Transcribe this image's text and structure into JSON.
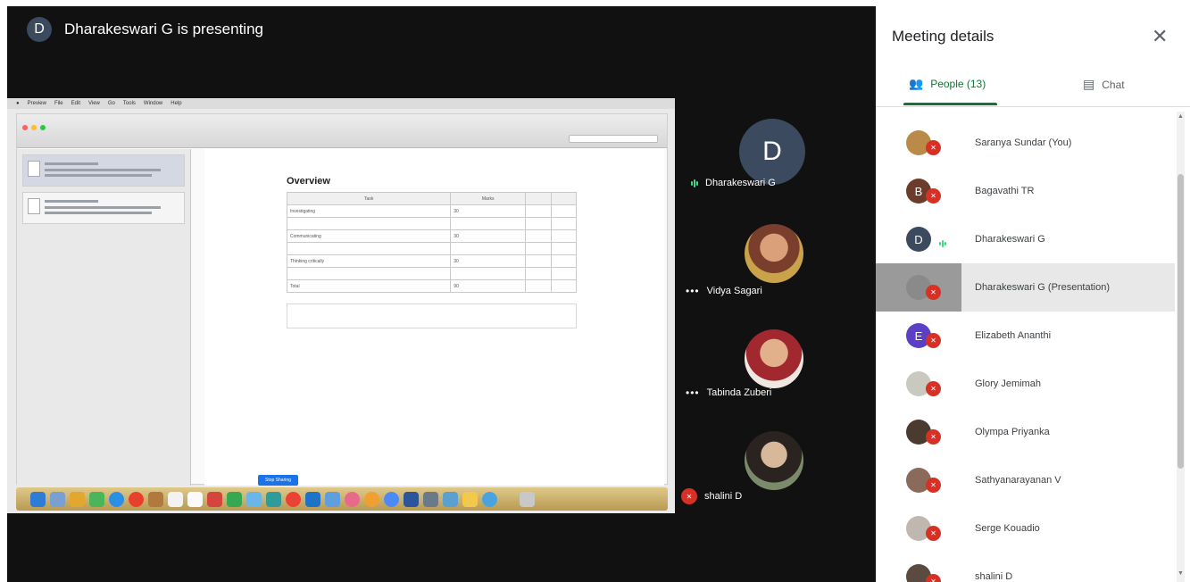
{
  "banner": {
    "avatar_letter": "D",
    "title": "Dharakeswari G is presenting"
  },
  "shared_screen": {
    "menu": [
      "Preview",
      "File",
      "Edit",
      "View",
      "Go",
      "Tools",
      "Window",
      "Help"
    ],
    "heading": "Overview",
    "table_header": [
      "Task",
      "Marks"
    ],
    "rows": [
      {
        "task": "Investigating",
        "marks": "30"
      },
      {
        "task": "Communicating",
        "marks": "30"
      },
      {
        "task": "Thinking critically",
        "marks": "30"
      },
      {
        "task": "Total",
        "marks": "90"
      }
    ],
    "stop_label": "Stop Sharing"
  },
  "tiles": [
    {
      "name": "Dharakeswari G",
      "avatar_letter": "D"
    },
    {
      "name": "Vidya Sagari"
    },
    {
      "name": "Tabinda Zuberi"
    },
    {
      "name": "shalini D"
    }
  ],
  "panel": {
    "title": "Meeting details",
    "tabs": {
      "people": "People (13)",
      "chat": "Chat"
    },
    "people": [
      {
        "name": "Saranya Sundar (You)",
        "avatar": "",
        "color": "#b98a4a",
        "muted": true
      },
      {
        "name": "Bagavathi TR",
        "avatar": "B",
        "color": "#6d3b2a",
        "muted": true
      },
      {
        "name": "Dharakeswari G",
        "avatar": "D",
        "color": "#3b4a5e",
        "muted": false
      },
      {
        "name": "Dharakeswari G (Presentation)",
        "avatar": "",
        "color": "#8a8a8a",
        "muted": true
      },
      {
        "name": "Elizabeth Ananthi",
        "avatar": "E",
        "color": "#5b3fc4",
        "muted": true
      },
      {
        "name": "Glory Jemimah",
        "avatar": "",
        "color": "#c9c9c0",
        "muted": true
      },
      {
        "name": "Olympa Priyanka",
        "avatar": "",
        "color": "#4b3a2e",
        "muted": true
      },
      {
        "name": "Sathyanarayanan V",
        "avatar": "",
        "color": "#8a6a5a",
        "muted": true
      },
      {
        "name": "Serge Kouadio",
        "avatar": "",
        "color": "#c0b8b0",
        "muted": true
      },
      {
        "name": "shalini D",
        "avatar": "",
        "color": "#5a4a40",
        "muted": true
      }
    ]
  }
}
